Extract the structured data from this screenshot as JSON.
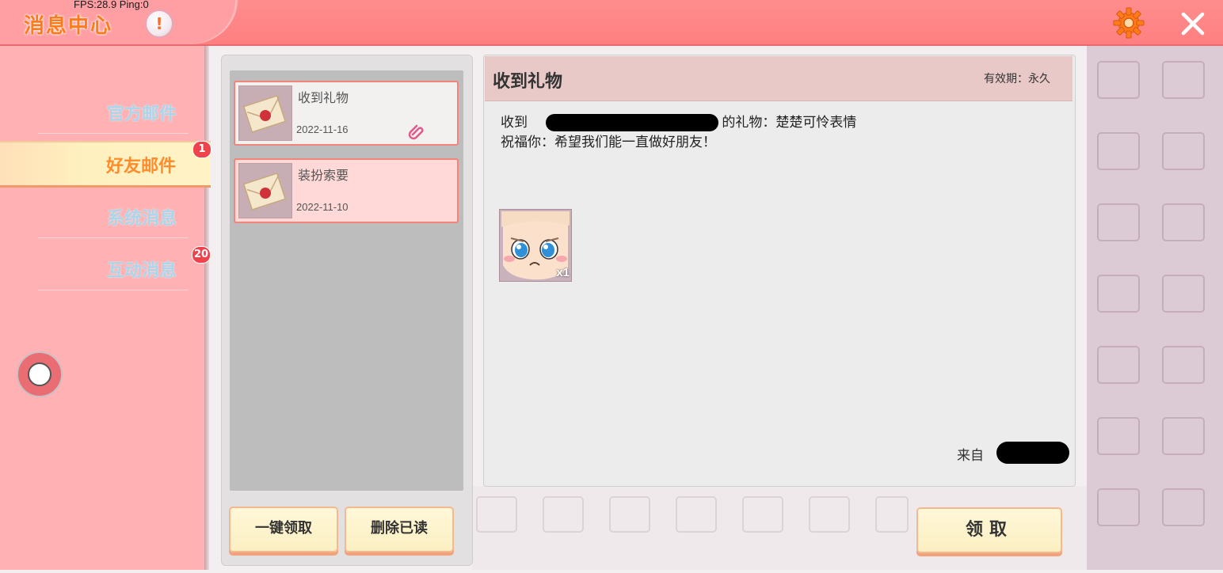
{
  "header": {
    "title": "消息中心",
    "fps": "FPS:28.9  Ping:0",
    "alert_glyph": "!"
  },
  "sidebar": {
    "items": [
      {
        "label": "官方邮件",
        "badge": ""
      },
      {
        "label": "好友邮件",
        "badge": "1"
      },
      {
        "label": "系统消息",
        "badge": ""
      },
      {
        "label": "互动消息",
        "badge": "20"
      }
    ]
  },
  "mail_list": {
    "items": [
      {
        "title": "收到礼物",
        "date": "2022-11-16",
        "state": "read",
        "has_attachment": true
      },
      {
        "title": "装扮索要",
        "date": "2022-11-10",
        "state": "unread",
        "has_attachment": false
      }
    ],
    "claim_all_label": "一键领取",
    "delete_read_label": "删除已读"
  },
  "detail": {
    "title": "收到礼物",
    "validity": "有效期：永久",
    "line1_prefix": "收到",
    "line1_suffix": "的礼物：楚楚可怜表情",
    "line2": "祝福你：希望我们能一直做好朋友！",
    "gift_qty": "x1",
    "from_label": "来自",
    "claim_label": "领取"
  },
  "colors": {
    "topbar": "#ff8d8d",
    "title_orange": "#ff7a18",
    "sidebar_bg": "#ffb1b3",
    "active_tab_text": "#ff8c2a",
    "inactive_tab_text": "#a8d6ea",
    "badge": "#f0424a",
    "button_fill": "#fff7d8"
  }
}
